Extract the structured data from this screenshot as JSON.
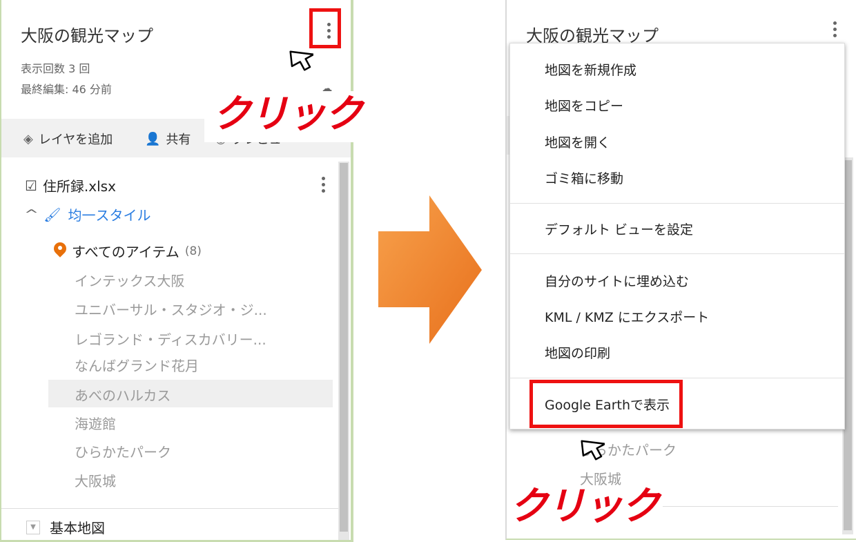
{
  "left": {
    "title": "大阪の観光マップ",
    "views": "表示回数 3 回",
    "last_edit": "最終編集: 46 分前",
    "toolbar": {
      "add_layer": "レイヤを追加",
      "share": "共有",
      "preview": "プレビュー"
    },
    "layer": {
      "name": "住所録.xlsx",
      "style": "均一スタイル",
      "all_items": "すべてのアイテム",
      "count": "(8)",
      "items": [
        "インテックス大阪",
        "ユニバーサル・スタジオ・ジ...",
        "レゴランド・ディスカバリー...",
        "なんばグランド花月",
        "あべのハルカス",
        "海遊館",
        "ひらかたパーク",
        "大阪城"
      ]
    },
    "base_map": "基本地図",
    "callout": "クリック"
  },
  "right": {
    "title": "大阪の観光マップ",
    "menu": [
      "地図を新規作成",
      "地図をコピー",
      "地図を開く",
      "ゴミ箱に移動",
      "デフォルト ビューを設定",
      "自分のサイトに埋め込む",
      "KML / KMZ にエクスポート",
      "地図の印刷",
      "Google Earthで表示"
    ],
    "behind_items": [
      "ひらかたパーク",
      "大阪城"
    ],
    "callout": "クリック"
  },
  "colors": {
    "highlight_red": "#ee1111",
    "callout_red": "#e50012",
    "arrow_orange": "#f08030",
    "link_blue": "#2a7de1",
    "pin_orange": "#e8700a"
  },
  "icons": {
    "menu": "vertical-dots-icon",
    "cursor": "mouse-pointer-icon",
    "arrow": "right-arrow-icon",
    "layers": "layers-icon",
    "share": "add-person-icon",
    "preview": "eye-icon",
    "pin": "map-pin-icon",
    "paint": "paint-roller-icon",
    "cloud": "cloud-sync-icon"
  }
}
